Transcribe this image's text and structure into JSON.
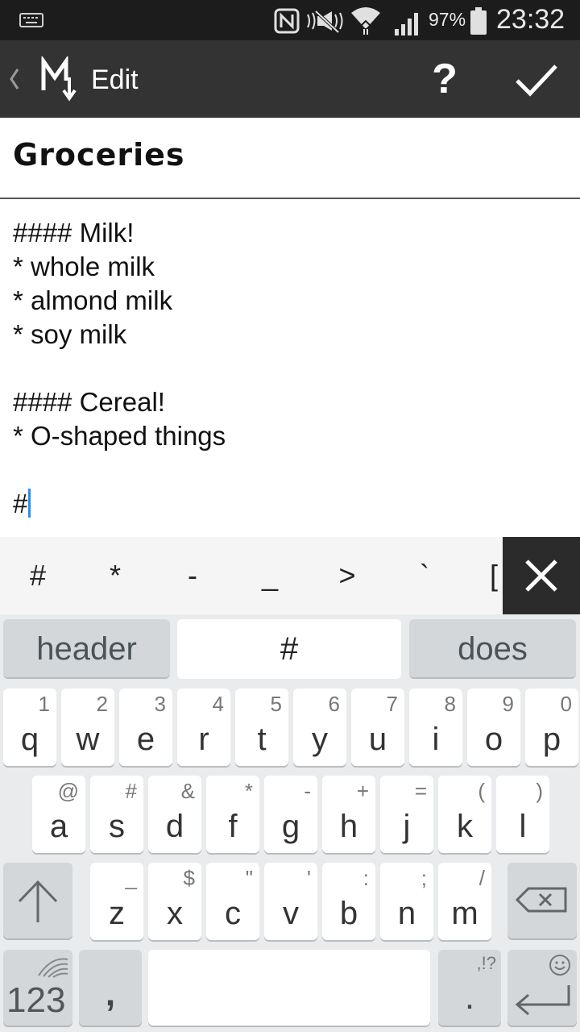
{
  "status_bar": {
    "battery_percent": "97%",
    "time": "23:32",
    "icons": [
      "keyboard-icon",
      "nfc-icon",
      "mute-icon",
      "wifi-icon",
      "signal-icon",
      "battery-icon"
    ]
  },
  "action_bar": {
    "title": "Edit",
    "help_label": "?",
    "icons": [
      "back-chevron-icon",
      "markdown-logo-icon",
      "checkmark-icon"
    ]
  },
  "note": {
    "title": "Groceries",
    "lines": [
      "#### Milk!",
      "* whole milk",
      "* almond milk",
      "* soy milk",
      "",
      "#### Cereal!",
      "* O-shaped things",
      "",
      "#"
    ]
  },
  "markdown_bar": {
    "keys": [
      "#",
      "*",
      "-",
      "_",
      ">",
      "`",
      "["
    ],
    "close_icon": "close-icon"
  },
  "keyboard": {
    "suggestions": [
      "header",
      "#",
      "does"
    ],
    "row1": [
      {
        "k": "q",
        "alt": "1"
      },
      {
        "k": "w",
        "alt": "2"
      },
      {
        "k": "e",
        "alt": "3"
      },
      {
        "k": "r",
        "alt": "4"
      },
      {
        "k": "t",
        "alt": "5"
      },
      {
        "k": "y",
        "alt": "6"
      },
      {
        "k": "u",
        "alt": "7"
      },
      {
        "k": "i",
        "alt": "8"
      },
      {
        "k": "o",
        "alt": "9"
      },
      {
        "k": "p",
        "alt": "0"
      }
    ],
    "row2": [
      {
        "k": "a",
        "alt": "@"
      },
      {
        "k": "s",
        "alt": "#"
      },
      {
        "k": "d",
        "alt": "&"
      },
      {
        "k": "f",
        "alt": "*"
      },
      {
        "k": "g",
        "alt": "-"
      },
      {
        "k": "h",
        "alt": "+"
      },
      {
        "k": "j",
        "alt": "="
      },
      {
        "k": "k",
        "alt": "("
      },
      {
        "k": "l",
        "alt": ")"
      }
    ],
    "row3": [
      {
        "k": "z",
        "alt": "_"
      },
      {
        "k": "x",
        "alt": "$"
      },
      {
        "k": "c",
        "alt": "\""
      },
      {
        "k": "v",
        "alt": "'"
      },
      {
        "k": "b",
        "alt": ":"
      },
      {
        "k": "n",
        "alt": ";"
      },
      {
        "k": "m",
        "alt": "/"
      }
    ],
    "numbers_label": "123",
    "comma_label": ",",
    "period_label": ".",
    "period_alt": ",!?",
    "icons": [
      "shift-icon",
      "backspace-icon",
      "swiftkey-logo-icon",
      "emoji-icon",
      "enter-icon"
    ]
  }
}
